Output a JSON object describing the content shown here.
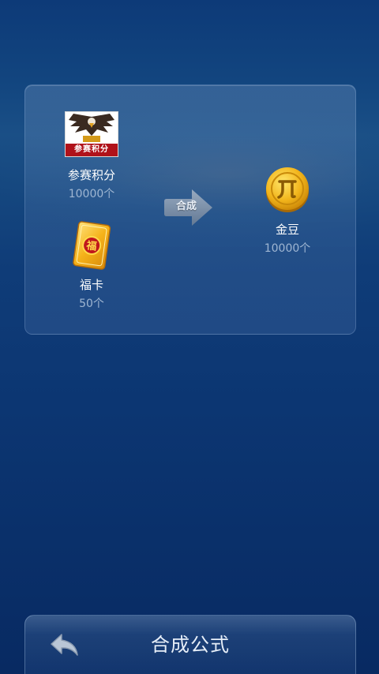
{
  "ingredients": [
    {
      "name": "参赛积分",
      "quantity": "10000个",
      "icon": "tournament-points-icon",
      "badge_text": "参赛积分"
    },
    {
      "name": "福卡",
      "quantity": "50个",
      "icon": "fortune-card-icon",
      "card_char": "福"
    }
  ],
  "combine": {
    "label": "合成"
  },
  "result": {
    "name": "金豆",
    "quantity": "10000个",
    "icon": "gold-coin-icon"
  },
  "footer": {
    "title": "合成公式",
    "back_icon": "back-arrow-icon"
  },
  "colors": {
    "accent_gold": "#f2b51c",
    "card_red": "#b0121a",
    "background": "#0c3672"
  }
}
